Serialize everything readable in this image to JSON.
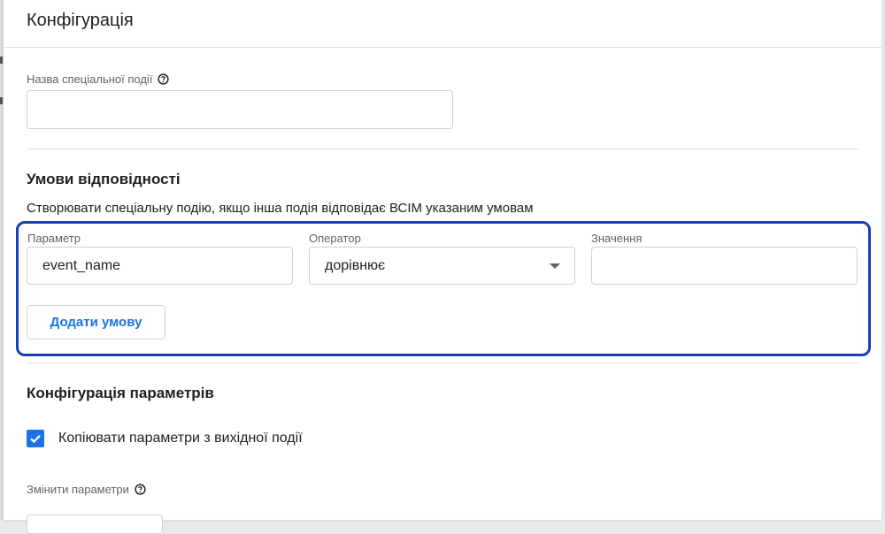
{
  "header": {
    "title": "Конфігурація"
  },
  "event_name_field": {
    "label": "Назва спеціальної події",
    "value": ""
  },
  "conditions": {
    "title": "Умови відповідності",
    "description": "Створювати спеціальну подію, якщо інша подія відповідає ВСІМ указаним умовам",
    "parameter": {
      "label": "Параметр",
      "value": "event_name"
    },
    "operator": {
      "label": "Оператор",
      "value": "дорівнює"
    },
    "value": {
      "label": "Значення",
      "value": ""
    },
    "add_button": "Додати умову"
  },
  "params_config": {
    "title": "Конфігурація параметрів",
    "copy_checkbox": {
      "label": "Копіювати параметри з вихідної події",
      "checked": true
    },
    "modify_label": "Змінити параметри"
  },
  "colors": {
    "accent": "#1a73e8",
    "highlight_border": "#1541b4"
  },
  "icons": {
    "help": "help-circle-icon",
    "dropdown": "triangle-down-icon",
    "check": "check-icon"
  }
}
